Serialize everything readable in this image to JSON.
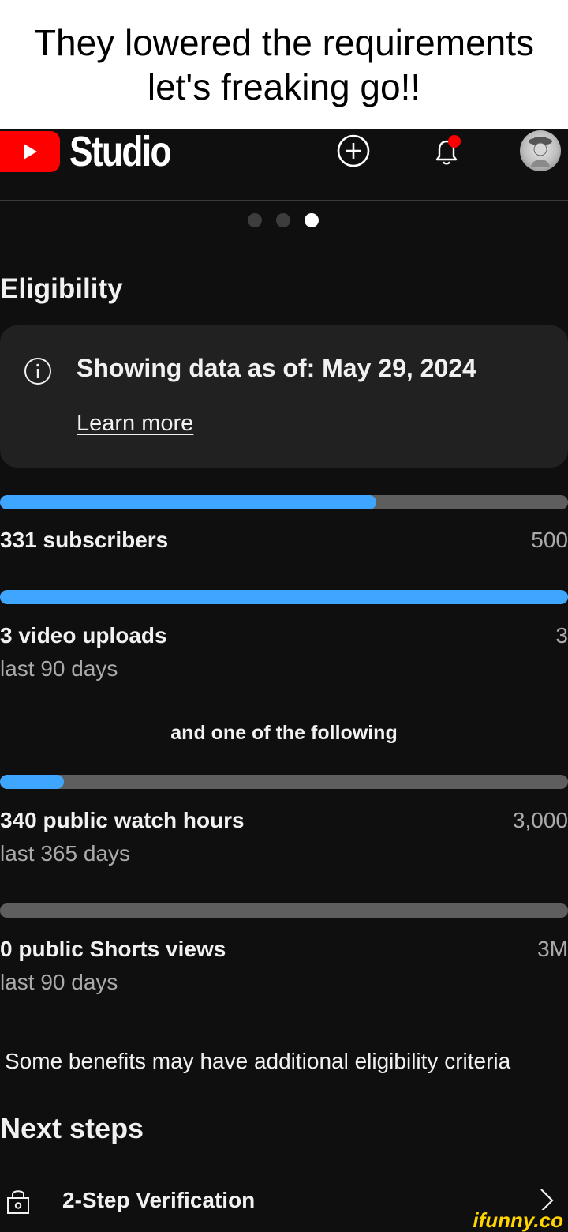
{
  "caption": {
    "line1": "They lowered the requirements",
    "line2": "let's freaking go!!"
  },
  "appbar": {
    "logo_text": "Studio",
    "icons": [
      "create-icon",
      "notifications-icon",
      "avatar"
    ],
    "accent": "#ff0000",
    "notification_dot": "#ff0000"
  },
  "carousel": {
    "dots": 3,
    "active_index": 2
  },
  "eligibility": {
    "heading": "Eligibility",
    "info": {
      "text": "Showing data as of: May 29, 2024",
      "link": "Learn more"
    },
    "requirements": [
      {
        "label": "331 subscribers",
        "sublabel": "",
        "target": "500",
        "progress": 0.662
      },
      {
        "label": "3 video uploads",
        "sublabel": "last 90 days",
        "target": "3",
        "progress": 1.0
      },
      {
        "label": "340 public watch hours",
        "sublabel": "last 365 days",
        "target": "3,000",
        "progress": 0.113
      },
      {
        "label": "0 public Shorts views",
        "sublabel": "last 90 days",
        "target": "3M",
        "progress": 0.0
      }
    ],
    "separator": "and one of the following",
    "note": "Some benefits may have additional eligibility criteria"
  },
  "next_steps": {
    "heading": "Next steps",
    "items": [
      {
        "label": "2-Step Verification",
        "icon": "lock-icon"
      }
    ]
  },
  "watermark": "ifunny.co",
  "colors": {
    "progress_fill": "#3ea6ff",
    "progress_track": "#5e5e5e",
    "card_bg": "#212121"
  }
}
